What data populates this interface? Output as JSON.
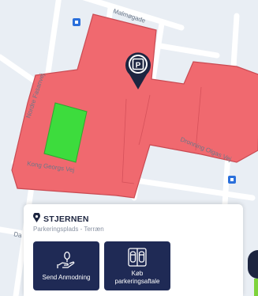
{
  "map": {
    "streets": {
      "s1": "Malmøgade",
      "s2": "Nordre Fasanvej",
      "s3": "Kong Georgs Vej",
      "s4": "Dronning Olgas Vej",
      "s5": "Da"
    },
    "colors": {
      "zone_fill": "#f0696f",
      "zone_stroke": "#c94a52",
      "free_spot": "#3ddc3d",
      "background": "#e9eef4",
      "road": "#ffffff"
    }
  },
  "pin": {
    "icon": "parking-location-pin-icon",
    "glyph": "P"
  },
  "card": {
    "icon": "location-pin-icon",
    "title": "STJERNEN",
    "subtitle": "Parkeringsplads - Terræn",
    "actions": [
      {
        "icon": "hand-send-icon",
        "label": "Send Anmodning"
      },
      {
        "icon": "car-agreement-icon",
        "label": "Køb\nparkeringsaftale"
      }
    ],
    "colors": {
      "button_bg": "#1f2a55",
      "title": "#1d2540"
    }
  }
}
